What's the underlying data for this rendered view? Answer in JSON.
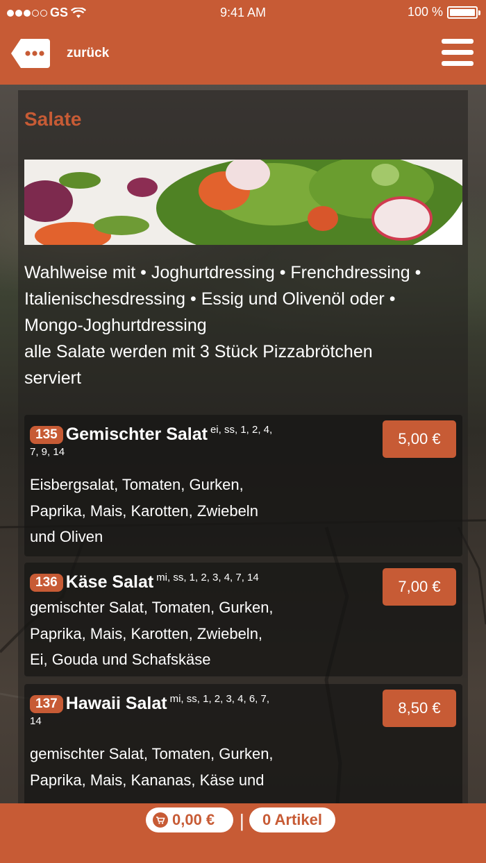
{
  "status_bar": {
    "carrier": "GS",
    "time": "9:41 AM",
    "battery_percent": "100 %"
  },
  "header": {
    "back_label": "zurück",
    "back_icon": "more-dots-tag-icon",
    "menu_icon": "hamburger-menu-icon"
  },
  "section": {
    "title": "Salate",
    "hero_image": "salad-bowl-photo",
    "description": [
      "Wahlweise mit • Joghurtdressing • Frenchdressing •",
      "Italienischesdressing • Essig und Olivenöl oder •",
      "Mongo-Joghurtdressing",
      "alle Salate werden mit 3 Stück Pizzabrötchen",
      "serviert"
    ]
  },
  "items": [
    {
      "number": "135",
      "name": "Gemischter Salat",
      "allergens": "ei, ss, 1, 2, 4,",
      "allergens_cont": "7, 9, 14",
      "description": [
        "Eisbergsalat, Tomaten, Gurken,",
        "Paprika, Mais, Karotten, Zwiebeln",
        "und Oliven"
      ],
      "price": "5,00 €"
    },
    {
      "number": "136",
      "name": "Käse Salat",
      "allergens": "mi, ss, 1, 2, 3, 4, 7, 14",
      "allergens_cont": "",
      "description": [
        "gemischter Salat, Tomaten, Gurken,",
        "Paprika, Mais, Karotten, Zwiebeln,",
        "Ei, Gouda und Schafskäse"
      ],
      "price": "7,00 €"
    },
    {
      "number": "137",
      "name": "Hawaii Salat",
      "allergens": "mi, ss, 1, 2, 3, 4, 6, 7,",
      "allergens_cont": "14",
      "description": [
        "gemischter Salat, Tomaten, Gurken,",
        "Paprika, Mais, Kananas, Käse und"
      ],
      "price": "8,50 €"
    }
  ],
  "footer": {
    "cart_total": "0,00 €",
    "separator": "|",
    "article_count": "0 Artikel",
    "cart_icon": "cart-icon"
  },
  "colors": {
    "brand": "#c75b35",
    "text": "#ffffff"
  }
}
